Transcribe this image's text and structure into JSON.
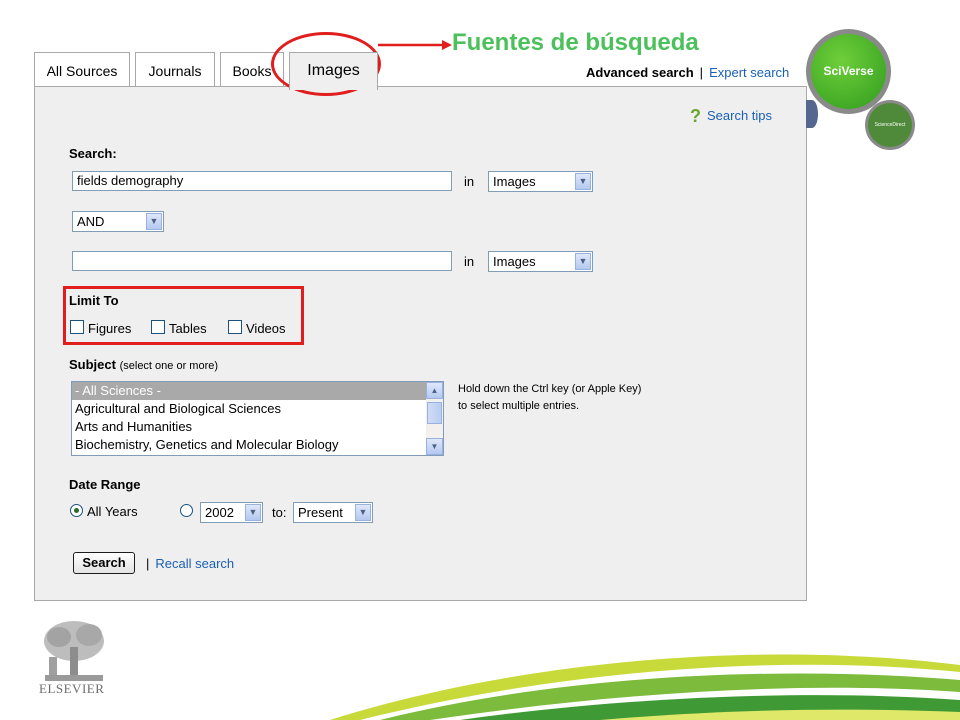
{
  "tabs": [
    {
      "label": "All Sources"
    },
    {
      "label": "Journals"
    },
    {
      "label": "Books"
    },
    {
      "label": "Images"
    }
  ],
  "top_links": {
    "advanced": "Advanced search",
    "separator": "|",
    "expert": "Expert search"
  },
  "annotation": {
    "title": "Fuentes de búsqueda",
    "color": "#4cc15b"
  },
  "brand": {
    "sciverse": "SciVerse",
    "sciencedirect": "ScienceDirect",
    "publisher": "ELSEVIER"
  },
  "help": {
    "icon": "question-icon",
    "label": "Search tips"
  },
  "search": {
    "label": "Search:",
    "term1": {
      "value": "fields demography",
      "in_label": "in",
      "source": "Images"
    },
    "operator": "AND",
    "term2": {
      "value": "",
      "in_label": "in",
      "source": "Images"
    }
  },
  "limit_to": {
    "label": "Limit To",
    "options": [
      {
        "label": "Figures",
        "checked": false
      },
      {
        "label": "Tables",
        "checked": false
      },
      {
        "label": "Videos",
        "checked": false
      }
    ]
  },
  "subject": {
    "label": "Subject",
    "note": "(select one or more)",
    "options": [
      {
        "label": "- All Sciences -",
        "selected": true
      },
      {
        "label": "Agricultural and Biological Sciences",
        "selected": false
      },
      {
        "label": "Arts and Humanities",
        "selected": false
      },
      {
        "label": "Biochemistry, Genetics and Molecular Biology",
        "selected": false
      }
    ],
    "hint_line1": "Hold down the Ctrl key (or Apple Key)",
    "hint_line2": "to select multiple entries."
  },
  "date_range": {
    "label": "Date Range",
    "all_years_label": "All Years",
    "all_years_selected": true,
    "from_year": "2002",
    "to_label": "to:",
    "to_value": "Present"
  },
  "actions": {
    "search_button": "Search",
    "separator": "|",
    "recall": "Recall search"
  },
  "colors": {
    "link": "#1b5fb4",
    "highlight": "#e01e1e",
    "panel": "#efefef"
  }
}
